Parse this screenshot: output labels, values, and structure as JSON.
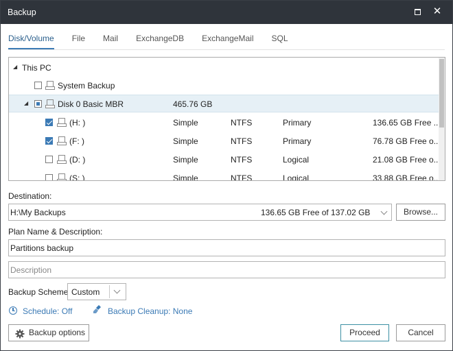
{
  "window": {
    "title": "Backup"
  },
  "tabs": [
    "Disk/Volume",
    "File",
    "Mail",
    "ExchangeDB",
    "ExchangeMail",
    "SQL"
  ],
  "tree": {
    "root": "This PC",
    "system_backup": "System Backup",
    "disk": {
      "name": "Disk 0 Basic MBR",
      "size": "465.76 GB"
    },
    "partitions": [
      {
        "name": "(H: )",
        "layout": "Simple",
        "fs": "NTFS",
        "type": "Primary",
        "free": "136.65 GB Free ...",
        "checked": true
      },
      {
        "name": "(F: )",
        "layout": "Simple",
        "fs": "NTFS",
        "type": "Primary",
        "free": "76.78 GB Free o...",
        "checked": true
      },
      {
        "name": "(D: )",
        "layout": "Simple",
        "fs": "NTFS",
        "type": "Logical",
        "free": "21.08 GB Free o...",
        "checked": false
      },
      {
        "name": "(S: )",
        "layout": "Simple",
        "fs": "NTFS",
        "type": "Logical",
        "free": "33.88 GB Free o...",
        "checked": false
      }
    ]
  },
  "destination": {
    "label": "Destination:",
    "path": "H:\\My Backups",
    "free": "136.65 GB Free of 137.02 GB",
    "browse": "Browse..."
  },
  "plan": {
    "label": "Plan Name & Description:",
    "name": "Partitions backup",
    "description_placeholder": "Description"
  },
  "scheme": {
    "label": "Backup Scheme:",
    "value": "Custom"
  },
  "schedule": "Schedule: Off",
  "cleanup": "Backup Cleanup: None",
  "buttons": {
    "options": "Backup options",
    "proceed": "Proceed",
    "cancel": "Cancel"
  },
  "colors": {
    "titlebar": "#2f343b",
    "accent": "#3b7ab5"
  }
}
